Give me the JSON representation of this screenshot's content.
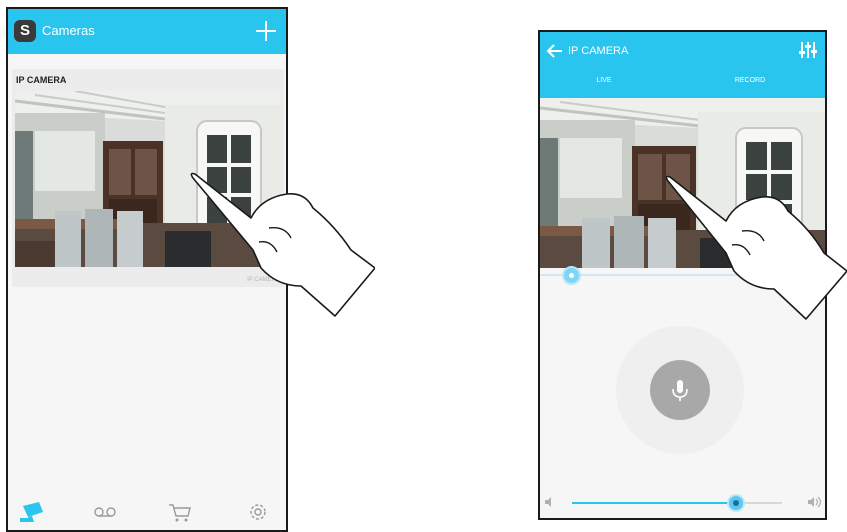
{
  "left_screen": {
    "app_bar": {
      "logo_letter": "S",
      "title": "Cameras",
      "add_icon": "plus-icon"
    },
    "camera_list": [
      {
        "name": "IP CAMERA",
        "thumbnail": "living-room-camera-snapshot",
        "caption": "IP CAMERA"
      }
    ],
    "bottom_nav": [
      {
        "icon": "camera-icon",
        "active": true
      },
      {
        "icon": "recordings-icon",
        "active": false
      },
      {
        "icon": "cart-icon",
        "active": false
      },
      {
        "icon": "gear-icon",
        "active": false
      }
    ]
  },
  "right_screen": {
    "app_bar": {
      "back_icon": "arrow-left-icon",
      "title": "IP CAMERA",
      "settings_icon": "sliders-icon"
    },
    "tabs": [
      {
        "label": "LIVE",
        "selected": true
      },
      {
        "label": "RECORD",
        "selected": false
      }
    ],
    "live_view": "living-room-camera-stream",
    "microphone": {
      "icon": "microphone-icon"
    },
    "volume": {
      "level": 0.78,
      "min_icon": "speaker-mute-icon",
      "max_icon": "speaker-loud-icon"
    }
  },
  "gesture": {
    "type": "tap",
    "icon": "pointing-hand-icon"
  },
  "colors": {
    "accent": "#29c5ee",
    "frame": "#1a1a1a",
    "background": "#f6f6f6",
    "mic_button": "#a8a8a8"
  }
}
